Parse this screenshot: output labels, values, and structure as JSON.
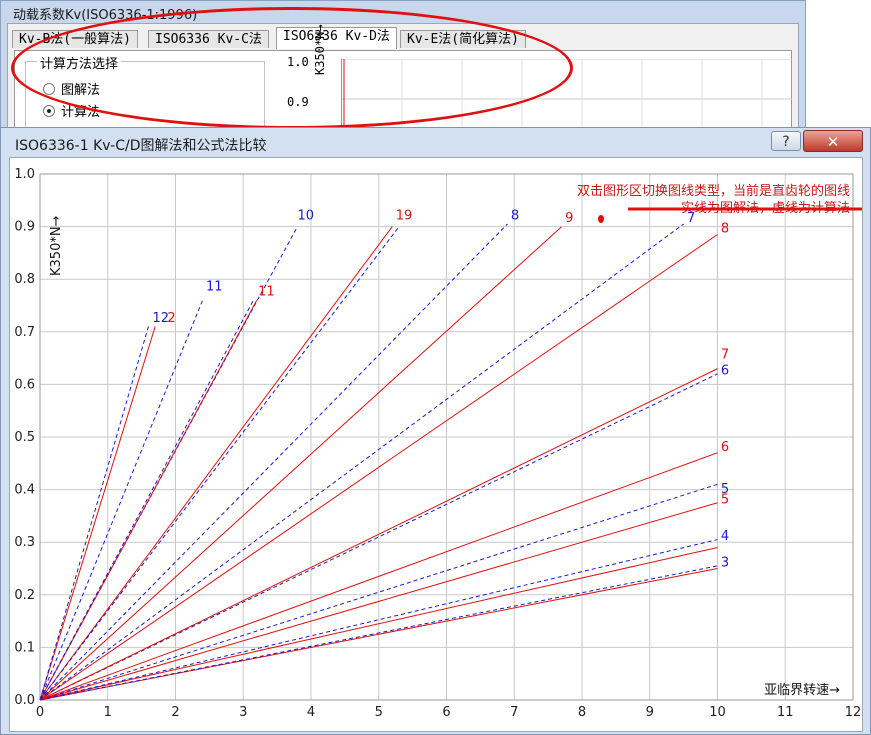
{
  "bg_window": {
    "title": "动载系数Kv(ISO6336-1:1996)",
    "tabs": [
      "Kv-B法(一般算法)",
      "ISO6336 Kv-C法",
      "ISO6336 Kv-D法",
      "Kv-E法(简化算法)"
    ],
    "active_tab": 2,
    "group_title": "计算方法选择",
    "radios": [
      {
        "label": "图解法",
        "selected": false
      },
      {
        "label": "计算法",
        "selected": true
      }
    ],
    "plot_ticks": [
      "1.0",
      "0.9"
    ],
    "plot_ylabel": "K350*N→"
  },
  "dialog": {
    "title": "ISO6336-1 Kv-C/D图解法和公式法比较",
    "help_label": "?",
    "close_label": "✕",
    "colors": {
      "solid": "#e01010",
      "dashed": "#1a1ad0",
      "grid": "#c8c8c8",
      "note": "#c81818"
    }
  },
  "chart_data": {
    "type": "line",
    "xlabel": "亚临界转速→",
    "ylabel": "K350*N→",
    "xlim": [
      0,
      12
    ],
    "ylim": [
      0,
      1.0
    ],
    "xticks": [
      "0",
      "1",
      "2",
      "3",
      "4",
      "5",
      "6",
      "7",
      "8",
      "9",
      "10",
      "11",
      "12"
    ],
    "yticks": [
      "0.0",
      "0.1",
      "0.2",
      "0.3",
      "0.4",
      "0.5",
      "0.6",
      "0.7",
      "0.8",
      "0.9",
      "1.0"
    ],
    "grid": true,
    "annotation_lines": [
      "双击图形区切换图线类型，当前是直齿轮的图线",
      "实线为图解法，虚线为计算法"
    ],
    "series": [
      {
        "label": "3",
        "style": "solid",
        "x": [
          0,
          10
        ],
        "y": [
          0,
          0.25
        ]
      },
      {
        "label": "3",
        "style": "dashed",
        "x": [
          0,
          10
        ],
        "y": [
          0,
          0.255
        ]
      },
      {
        "label": "4",
        "style": "solid",
        "x": [
          0,
          10
        ],
        "y": [
          0,
          0.29
        ]
      },
      {
        "label": "4",
        "style": "dashed",
        "x": [
          0,
          10
        ],
        "y": [
          0,
          0.305
        ]
      },
      {
        "label": "5",
        "style": "solid",
        "x": [
          0,
          10
        ],
        "y": [
          0,
          0.375
        ]
      },
      {
        "label": "5",
        "style": "dashed",
        "x": [
          0,
          10
        ],
        "y": [
          0,
          0.41
        ]
      },
      {
        "label": "6",
        "style": "solid",
        "x": [
          0,
          10
        ],
        "y": [
          0,
          0.47
        ]
      },
      {
        "label": "6",
        "style": "dashed",
        "x": [
          0,
          10
        ],
        "y": [
          0,
          0.62
        ]
      },
      {
        "label": "7",
        "style": "solid",
        "x": [
          0,
          10
        ],
        "y": [
          0,
          0.63
        ]
      },
      {
        "label": "8",
        "style": "solid",
        "x": [
          0,
          10
        ],
        "y": [
          0,
          0.885
        ]
      },
      {
        "label": "7",
        "style": "dashed",
        "x": [
          0,
          9.5
        ],
        "y": [
          0,
          0.905
        ]
      },
      {
        "label": "9",
        "style": "solid",
        "x": [
          0,
          7.7
        ],
        "y": [
          0,
          0.9
        ]
      },
      {
        "label": "8",
        "style": "dashed",
        "x": [
          0,
          6.9
        ],
        "y": [
          0,
          0.905
        ]
      },
      {
        "label": "19",
        "style": "solid",
        "x": [
          0,
          5.2
        ],
        "y": [
          0,
          0.9
        ]
      },
      {
        "label": "9",
        "style": "dashed",
        "x": [
          0,
          5.3
        ],
        "y": [
          0,
          0.9
        ]
      },
      {
        "label": "10",
        "style": "dashed",
        "x": [
          0,
          3.8
        ],
        "y": [
          0,
          0.9
        ]
      },
      {
        "label": "11",
        "style": "solid",
        "x": [
          0,
          3.2
        ],
        "y": [
          0,
          0.76
        ]
      },
      {
        "label": "10",
        "style": "dashed",
        "x": [
          0,
          3.15
        ],
        "y": [
          0,
          0.76
        ]
      },
      {
        "label": "11",
        "style": "dashed",
        "x": [
          0,
          2.4
        ],
        "y": [
          0,
          0.76
        ]
      },
      {
        "label": "12",
        "style": "solid",
        "x": [
          0,
          1.7
        ],
        "y": [
          0,
          0.71
        ]
      },
      {
        "label": "12",
        "style": "dashed",
        "x": [
          0,
          1.6
        ],
        "y": [
          0,
          0.71
        ]
      }
    ],
    "labels": [
      {
        "text": "3",
        "x": 10.05,
        "y": 0.25,
        "style": "dashed"
      },
      {
        "text": "4",
        "x": 10.05,
        "y": 0.3,
        "style": "dashed"
      },
      {
        "text": "5",
        "x": 10.05,
        "y": 0.39,
        "style": "dashed"
      },
      {
        "text": "5",
        "x": 10.05,
        "y": 0.37,
        "style": "solid"
      },
      {
        "text": "6",
        "x": 10.05,
        "y": 0.47,
        "style": "solid"
      },
      {
        "text": "6",
        "x": 10.05,
        "y": 0.615,
        "style": "dashed"
      },
      {
        "text": "7",
        "x": 10.05,
        "y": 0.645,
        "style": "solid"
      },
      {
        "text": "8",
        "x": 10.05,
        "y": 0.885,
        "style": "solid"
      },
      {
        "text": "7",
        "x": 9.55,
        "y": 0.905,
        "style": "dashed"
      },
      {
        "text": "9",
        "x": 7.75,
        "y": 0.905,
        "style": "solid"
      },
      {
        "text": "8",
        "x": 6.95,
        "y": 0.91,
        "style": "dashed"
      },
      {
        "text": "19",
        "x": 5.25,
        "y": 0.91,
        "style": "solid"
      },
      {
        "text": "10",
        "x": 3.8,
        "y": 0.91,
        "style": "dashed"
      },
      {
        "text": "11",
        "x": 3.22,
        "y": 0.765,
        "style": "solid"
      },
      {
        "text": "11",
        "x": 2.45,
        "y": 0.775,
        "style": "dashed"
      },
      {
        "text": "12",
        "x": 1.66,
        "y": 0.715,
        "style": "dashed"
      },
      {
        "text": "2",
        "x": 1.88,
        "y": 0.715,
        "style": "solid"
      }
    ]
  }
}
